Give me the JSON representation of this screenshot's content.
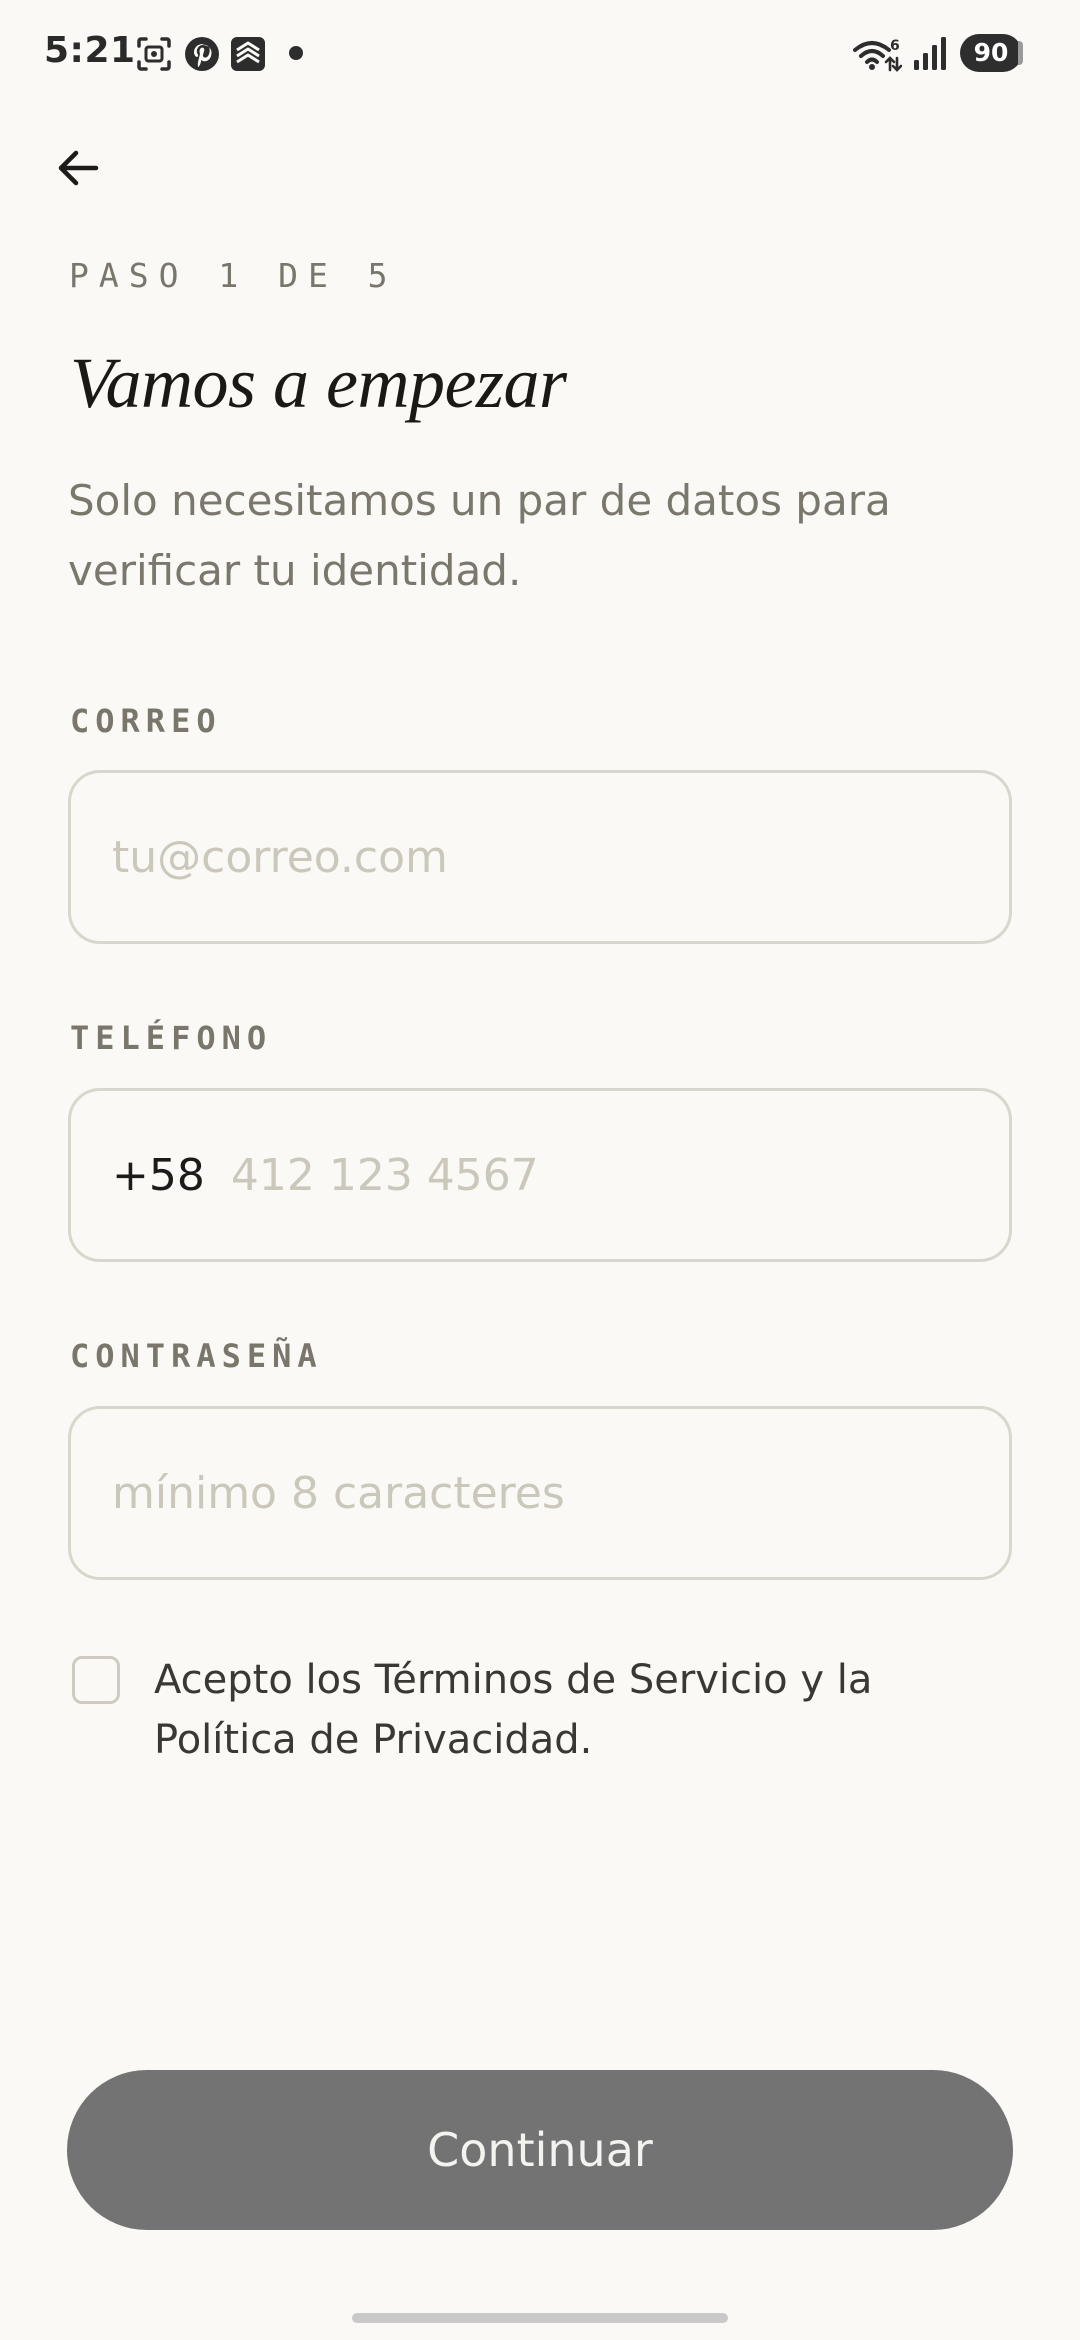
{
  "status_bar": {
    "time": "5:21",
    "battery": "90",
    "wifi_badge": "6",
    "left_icons": [
      "screenshot-icon",
      "pinterest-icon",
      "stack-app-icon",
      "notification-dot"
    ],
    "right_icons": [
      "wifi-icon",
      "signal-icon",
      "battery-icon"
    ]
  },
  "header": {
    "back_icon": "arrow-left-icon",
    "step": "PASO 1 DE 5",
    "title": "Vamos a empezar",
    "subtitle": "Solo necesitamos un par de datos para verificar tu identidad."
  },
  "form": {
    "email": {
      "label": "CORREO",
      "value": "",
      "placeholder": "tu@correo.com"
    },
    "phone": {
      "label": "TELÉFONO",
      "prefix": "+58",
      "value": "",
      "placeholder": "412 123 4567"
    },
    "password": {
      "label": "CONTRASEÑA",
      "value": "",
      "placeholder": "mínimo 8 caracteres"
    },
    "terms": {
      "checked": false,
      "text": "Acepto los Términos de Servicio y la Política de Privacidad."
    }
  },
  "actions": {
    "continue_label": "Continuar"
  },
  "colors": {
    "background": "#faf9f6",
    "muted_text": "#7a766c",
    "field_border": "#d9d6cc",
    "placeholder": "#cbc7bb",
    "button_disabled": "#737373"
  }
}
